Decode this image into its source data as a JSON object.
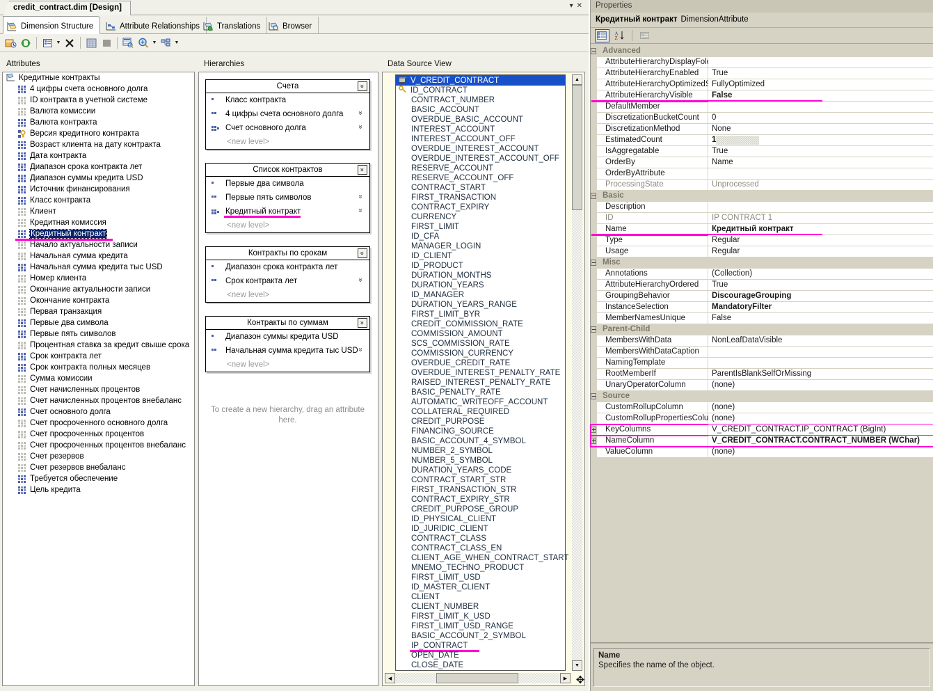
{
  "document": {
    "tab_title": "credit_contract.dim [Design]",
    "win_buttons": [
      "▾",
      "✕"
    ]
  },
  "view_tabs": [
    {
      "label": "Dimension Structure",
      "icon": "dimension-structure-icon",
      "active": true
    },
    {
      "label": "Attribute Relationships",
      "icon": "attribute-relationships-icon",
      "active": false
    },
    {
      "label": "Translations",
      "icon": "translations-icon",
      "active": false
    },
    {
      "label": "Browser",
      "icon": "browser-icon",
      "active": false
    }
  ],
  "toolbar": {
    "buttons": [
      "new-attribute-icon",
      "refresh-icon",
      "sep",
      "show-attributes-list-icon",
      "dropdown-arrow",
      "delete-icon",
      "sep",
      "grid-view-icon",
      "fill-icon",
      "sep",
      "show-table-icon",
      "zoom-icon",
      "dropdown-arrow",
      "arrange-icon",
      "dropdown-arrow"
    ]
  },
  "panels": {
    "attributes_header": "Attributes",
    "hierarchies_header": "Hierarchies",
    "dsv_header": "Data Source View"
  },
  "attributes": {
    "root": "Кредитные контракты",
    "items": [
      {
        "label": "4 цифры счета основного долга",
        "icon": "attribute-icon",
        "state": "enabled"
      },
      {
        "label": "ID контракта в учетной системе",
        "icon": "attribute-icon",
        "state": "disabled"
      },
      {
        "label": "Валюта комиссии",
        "icon": "attribute-icon",
        "state": "disabled"
      },
      {
        "label": "Валюта контракта",
        "icon": "attribute-icon",
        "state": "enabled"
      },
      {
        "label": "Версия кредитного контракта",
        "icon": "key-attribute-icon",
        "state": "key"
      },
      {
        "label": "Возраст клиента на дату контракта",
        "icon": "attribute-icon",
        "state": "enabled"
      },
      {
        "label": "Дата контракта",
        "icon": "attribute-icon",
        "state": "enabled"
      },
      {
        "label": "Диапазон срока контракта лет",
        "icon": "attribute-icon",
        "state": "enabled"
      },
      {
        "label": "Диапазон суммы кредита USD",
        "icon": "attribute-icon",
        "state": "enabled"
      },
      {
        "label": "Источник финансирования",
        "icon": "attribute-icon",
        "state": "enabled"
      },
      {
        "label": "Класс контракта",
        "icon": "attribute-icon",
        "state": "enabled"
      },
      {
        "label": "Клиент",
        "icon": "attribute-icon",
        "state": "disabled"
      },
      {
        "label": "Кредитная комиссия",
        "icon": "attribute-icon",
        "state": "disabled"
      },
      {
        "label": "Кредитный контракт",
        "icon": "attribute-icon",
        "state": "enabled",
        "selected": true,
        "highlighted": true
      },
      {
        "label": "Начало актуальности записи",
        "icon": "attribute-icon",
        "state": "disabled"
      },
      {
        "label": "Начальная сумма кредита",
        "icon": "attribute-icon",
        "state": "disabled"
      },
      {
        "label": "Начальная сумма кредита тыс USD",
        "icon": "attribute-icon",
        "state": "enabled"
      },
      {
        "label": "Номер клиента",
        "icon": "attribute-icon",
        "state": "disabled"
      },
      {
        "label": "Окончание актуальности записи",
        "icon": "attribute-icon",
        "state": "disabled"
      },
      {
        "label": "Окончание контракта",
        "icon": "attribute-icon",
        "state": "disabled"
      },
      {
        "label": "Первая транзакция",
        "icon": "attribute-icon",
        "state": "disabled"
      },
      {
        "label": "Первые два символа",
        "icon": "attribute-icon",
        "state": "enabled"
      },
      {
        "label": "Первые пять символов",
        "icon": "attribute-icon",
        "state": "enabled"
      },
      {
        "label": "Процентная ставка за кредит свыше срока",
        "icon": "attribute-icon",
        "state": "disabled"
      },
      {
        "label": "Срок контракта лет",
        "icon": "attribute-icon",
        "state": "enabled"
      },
      {
        "label": "Срок контракта полных месяцев",
        "icon": "attribute-icon",
        "state": "enabled"
      },
      {
        "label": "Сумма комиссии",
        "icon": "attribute-icon",
        "state": "disabled"
      },
      {
        "label": "Счет начисленных процентов",
        "icon": "attribute-icon",
        "state": "disabled"
      },
      {
        "label": "Счет начисленных процентов внебаланс",
        "icon": "attribute-icon",
        "state": "disabled"
      },
      {
        "label": "Счет основного долга",
        "icon": "attribute-icon",
        "state": "enabled"
      },
      {
        "label": "Счет просроченного основного долга",
        "icon": "attribute-icon",
        "state": "disabled"
      },
      {
        "label": "Счет просроченных процентов",
        "icon": "attribute-icon",
        "state": "disabled"
      },
      {
        "label": "Счет просроченных процентов внебаланс",
        "icon": "attribute-icon",
        "state": "disabled"
      },
      {
        "label": "Счет резервов",
        "icon": "attribute-icon",
        "state": "disabled"
      },
      {
        "label": "Счет резервов внебаланс",
        "icon": "attribute-icon",
        "state": "disabled"
      },
      {
        "label": "Требуется обеспечение",
        "icon": "attribute-icon",
        "state": "enabled"
      },
      {
        "label": "Цель кредита",
        "icon": "attribute-icon",
        "state": "enabled"
      }
    ]
  },
  "hierarchies": {
    "new_level_label": "<new level>",
    "hint": "To create a new hierarchy, drag an attribute here.",
    "boxes": [
      {
        "title": "Счета",
        "levels": [
          {
            "label": "Класс контракта",
            "rank": 1,
            "chevron": false
          },
          {
            "label": "4 цифры счета основного долга",
            "rank": 2,
            "chevron": true
          },
          {
            "label": "Счет основного долга",
            "rank": 3,
            "chevron": true
          }
        ]
      },
      {
        "title": "Список контрактов",
        "levels": [
          {
            "label": "Первые два символа",
            "rank": 1,
            "chevron": false
          },
          {
            "label": "Первые пять символов",
            "rank": 2,
            "chevron": true
          },
          {
            "label": "Кредитный контракт",
            "rank": 3,
            "chevron": true,
            "highlighted": true
          }
        ]
      },
      {
        "title": "Контракты по срокам",
        "levels": [
          {
            "label": "Диапазон срока контракта лет",
            "rank": 1,
            "chevron": false
          },
          {
            "label": "Срок контракта лет",
            "rank": 2,
            "chevron": true
          }
        ]
      },
      {
        "title": "Контракты по суммам",
        "levels": [
          {
            "label": "Диапазон суммы кредита USD",
            "rank": 1,
            "chevron": false
          },
          {
            "label": "Начальная сумма кредита тыс USD",
            "rank": 2,
            "chevron": true
          }
        ]
      }
    ]
  },
  "data_source_view": {
    "table_name": "V_CREDIT_CONTRACT",
    "columns": [
      {
        "name": "ID_CONTRACT",
        "key": true
      },
      {
        "name": "CONTRACT_NUMBER"
      },
      {
        "name": "BASIC_ACCOUNT"
      },
      {
        "name": "OVERDUE_BASIC_ACCOUNT"
      },
      {
        "name": "INTEREST_ACCOUNT"
      },
      {
        "name": "INTEREST_ACCOUNT_OFF"
      },
      {
        "name": "OVERDUE_INTEREST_ACCOUNT"
      },
      {
        "name": "OVERDUE_INTEREST_ACCOUNT_OFF"
      },
      {
        "name": "RESERVE_ACCOUNT"
      },
      {
        "name": "RESERVE_ACCOUNT_OFF"
      },
      {
        "name": "CONTRACT_START"
      },
      {
        "name": "FIRST_TRANSACTION"
      },
      {
        "name": "CONTRACT_EXPIRY"
      },
      {
        "name": "CURRENCY"
      },
      {
        "name": "FIRST_LIMIT"
      },
      {
        "name": "ID_CFA"
      },
      {
        "name": "MANAGER_LOGIN"
      },
      {
        "name": "ID_CLIENT"
      },
      {
        "name": "ID_PRODUCT"
      },
      {
        "name": "DURATION_MONTHS"
      },
      {
        "name": "DURATION_YEARS"
      },
      {
        "name": "ID_MANAGER"
      },
      {
        "name": "DURATION_YEARS_RANGE"
      },
      {
        "name": "FIRST_LIMIT_BYR"
      },
      {
        "name": "CREDIT_COMMISSION_RATE"
      },
      {
        "name": "COMMISSION_AMOUNT"
      },
      {
        "name": "SCS_COMMISSION_RATE"
      },
      {
        "name": "COMMISSION_CURRENCY"
      },
      {
        "name": "OVERDUE_CREDIT_RATE"
      },
      {
        "name": "OVERDUE_INTEREST_PENALTY_RATE"
      },
      {
        "name": "RAISED_INTEREST_PENALTY_RATE"
      },
      {
        "name": "BASIC_PENALTY_RATE"
      },
      {
        "name": "AUTOMATIC_WRITEOFF_ACCOUNT"
      },
      {
        "name": "COLLATERAL_REQUIRED"
      },
      {
        "name": "CREDIT_PURPOSE"
      },
      {
        "name": "FINANCING_SOURCE"
      },
      {
        "name": "BASIC_ACCOUNT_4_SYMBOL"
      },
      {
        "name": "NUMBER_2_SYMBOL"
      },
      {
        "name": "NUMBER_5_SYMBOL"
      },
      {
        "name": "DURATION_YEARS_CODE"
      },
      {
        "name": "CONTRACT_START_STR"
      },
      {
        "name": "FIRST_TRANSACTION_STR"
      },
      {
        "name": "CONTRACT_EXPIRY_STR"
      },
      {
        "name": "CREDIT_PURPOSE_GROUP"
      },
      {
        "name": "ID_PHYSICAL_CLIENT"
      },
      {
        "name": "ID_JURIDIC_CLIENT"
      },
      {
        "name": "CONTRACT_CLASS"
      },
      {
        "name": "CONTRACT_CLASS_EN"
      },
      {
        "name": "CLIENT_AGE_WHEN_CONTRACT_START"
      },
      {
        "name": "MNEMO_TECHNO_PRODUCT"
      },
      {
        "name": "FIRST_LIMIT_USD"
      },
      {
        "name": "ID_MASTER_CLIENT"
      },
      {
        "name": "CLIENT"
      },
      {
        "name": "CLIENT_NUMBER"
      },
      {
        "name": "FIRST_LIMIT_K_USD"
      },
      {
        "name": "FIRST_LIMIT_USD_RANGE"
      },
      {
        "name": "BASIC_ACCOUNT_2_SYMBOL"
      },
      {
        "name": "IP_CONTRACT",
        "highlighted": true
      },
      {
        "name": "OPEN_DATE"
      },
      {
        "name": "CLOSE_DATE"
      }
    ]
  },
  "properties": {
    "title": "Properties",
    "object_name": "Кредитный контракт",
    "object_type": "DimensionAttribute",
    "toolbar": [
      "categorized-view-icon",
      "alphabetical-sort-icon",
      "property-pages-icon"
    ],
    "rows": [
      {
        "kind": "category",
        "name": "Advanced"
      },
      {
        "name": "AttributeHierarchyDisplayFolder",
        "value": ""
      },
      {
        "name": "AttributeHierarchyEnabled",
        "value": "True"
      },
      {
        "name": "AttributeHierarchyOptimizedState",
        "value": "FullyOptimized"
      },
      {
        "name": "AttributeHierarchyVisible",
        "value": "False",
        "bold": true,
        "underline": true
      },
      {
        "name": "DefaultMember",
        "value": ""
      },
      {
        "name": "DiscretizationBucketCount",
        "value": "0"
      },
      {
        "name": "DiscretizationMethod",
        "value": "None"
      },
      {
        "name": "EstimatedCount",
        "value": "1",
        "bold": true,
        "redacted": true
      },
      {
        "name": "IsAggregatable",
        "value": "True"
      },
      {
        "name": "OrderBy",
        "value": "Name"
      },
      {
        "name": "OrderByAttribute",
        "value": ""
      },
      {
        "name": "ProcessingState",
        "value": "Unprocessed",
        "dim": true
      },
      {
        "kind": "category",
        "name": "Basic"
      },
      {
        "name": "Description",
        "value": ""
      },
      {
        "name": "ID",
        "value": "IP CONTRACT 1",
        "dim": true
      },
      {
        "name": "Name",
        "value": "Кредитный контракт",
        "bold": true,
        "underline": true
      },
      {
        "name": "Type",
        "value": "Regular"
      },
      {
        "name": "Usage",
        "value": "Regular"
      },
      {
        "kind": "category",
        "name": "Misc"
      },
      {
        "name": "Annotations",
        "value": "(Collection)"
      },
      {
        "name": "AttributeHierarchyOrdered",
        "value": "True"
      },
      {
        "name": "GroupingBehavior",
        "value": "DiscourageGrouping",
        "bold": true
      },
      {
        "name": "InstanceSelection",
        "value": "MandatoryFilter",
        "bold": true
      },
      {
        "name": "MemberNamesUnique",
        "value": "False"
      },
      {
        "kind": "category",
        "name": "Parent-Child"
      },
      {
        "name": "MembersWithData",
        "value": "NonLeafDataVisible"
      },
      {
        "name": "MembersWithDataCaption",
        "value": ""
      },
      {
        "name": "NamingTemplate",
        "value": ""
      },
      {
        "name": "RootMemberIf",
        "value": "ParentIsBlankSelfOrMissing"
      },
      {
        "name": "UnaryOperatorColumn",
        "value": "(none)"
      },
      {
        "kind": "category",
        "name": "Source"
      },
      {
        "name": "CustomRollupColumn",
        "value": "(none)"
      },
      {
        "name": "CustomRollupPropertiesColumn",
        "value": "(none)"
      },
      {
        "name": "KeyColumns",
        "value": "V_CREDIT_CONTRACT.IP_CONTRACT (BigInt)",
        "expandable": true,
        "boxed": true
      },
      {
        "name": "NameColumn",
        "value": "V_CREDIT_CONTRACT.CONTRACT_NUMBER (WChar)",
        "expandable": true,
        "bold": true,
        "boxed": true
      },
      {
        "name": "ValueColumn",
        "value": "(none)"
      }
    ],
    "description": {
      "title": "Name",
      "body": "Specifies the name of the object."
    }
  },
  "colors": {
    "highlight_magenta": "#ff00d4",
    "selection_blue": "#0a246a",
    "dsv_title_blue": "#1750c8",
    "props_bg": "#d6d3c4"
  }
}
